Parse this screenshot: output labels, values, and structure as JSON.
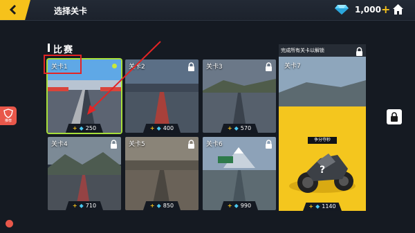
{
  "header": {
    "title": "选择关卡",
    "gems": "1,000",
    "plus": "+"
  },
  "side_badge": {
    "label": "推荐"
  },
  "section": {
    "title": "比赛"
  },
  "levels": [
    {
      "label": "关卡1",
      "price": "250",
      "locked": false,
      "selected": true
    },
    {
      "label": "关卡2",
      "price": "400",
      "locked": true
    },
    {
      "label": "关卡3",
      "price": "570",
      "locked": true
    },
    {
      "label": "关卡4",
      "price": "710",
      "locked": true
    },
    {
      "label": "关卡5",
      "price": "850",
      "locked": true
    },
    {
      "label": "关卡6",
      "price": "990",
      "locked": true
    }
  ],
  "big_level": {
    "unlock_text": "完成所有关卡以解锁",
    "label": "关卡7",
    "reward_title": "争分夺秒",
    "price": "1140"
  },
  "price_prefix": "+",
  "colors": {
    "accent": "#f6c21b",
    "selected": "#a8e03a",
    "gem": "#4ac8f0",
    "highlight": "#e32424"
  }
}
